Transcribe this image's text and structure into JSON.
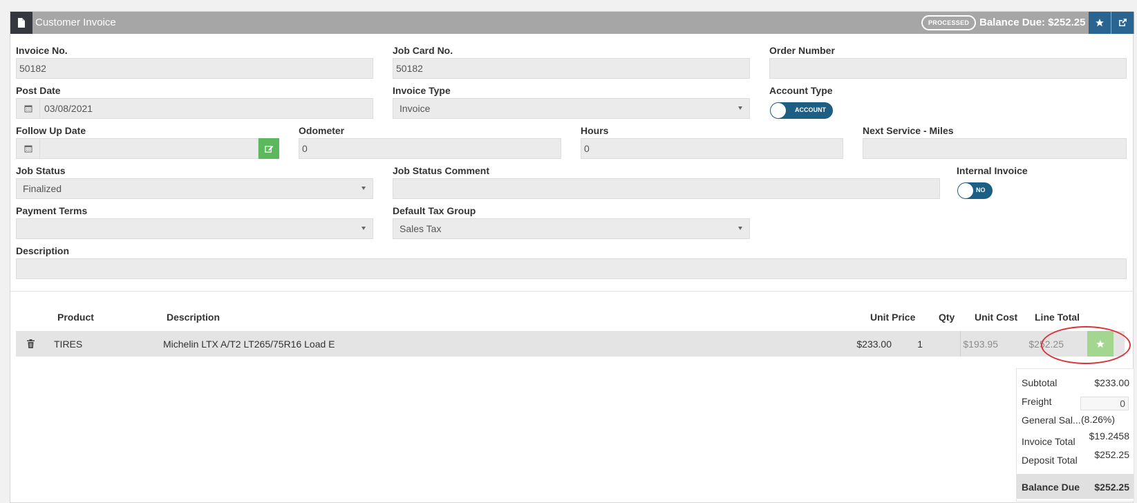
{
  "header": {
    "title": "Customer Invoice",
    "status_badge": "PROCESSED",
    "balance_due": "Balance Due: $252.25"
  },
  "fields": {
    "invoice_no": {
      "label": "Invoice No.",
      "value": "50182"
    },
    "job_card_no": {
      "label": "Job Card No.",
      "value": "50182"
    },
    "order_number": {
      "label": "Order Number",
      "value": ""
    },
    "post_date": {
      "label": "Post Date",
      "value": "03/08/2021"
    },
    "invoice_type": {
      "label": "Invoice Type",
      "value": "Invoice"
    },
    "account_type": {
      "label": "Account Type",
      "value": "ACCOUNT"
    },
    "follow_up_date": {
      "label": "Follow Up Date",
      "value": ""
    },
    "odometer": {
      "label": "Odometer",
      "value": "0"
    },
    "hours": {
      "label": "Hours",
      "value": "0"
    },
    "next_service_miles": {
      "label": "Next Service - Miles",
      "value": ""
    },
    "job_status": {
      "label": "Job Status",
      "value": "Finalized"
    },
    "job_status_comment": {
      "label": "Job Status Comment",
      "value": ""
    },
    "internal_invoice": {
      "label": "Internal Invoice",
      "value": "NO"
    },
    "payment_terms": {
      "label": "Payment Terms",
      "value": ""
    },
    "default_tax_group": {
      "label": "Default Tax Group",
      "value": "Sales Tax"
    },
    "description": {
      "label": "Description",
      "value": ""
    }
  },
  "line_items": {
    "columns": {
      "product": "Product",
      "description": "Description",
      "unit_price": "Unit Price",
      "qty": "Qty",
      "unit_cost": "Unit Cost",
      "line_total": "Line Total"
    },
    "rows": [
      {
        "product": "TIRES",
        "description": "Michelin LTX A/T2 LT265/75R16 Load E",
        "unit_price": "$233.00",
        "qty": "1",
        "unit_cost": "$193.95",
        "line_total": "$252.25"
      }
    ]
  },
  "totals": {
    "subtotal_label": "Subtotal",
    "subtotal_value": "$233.00",
    "freight_label": "Freight",
    "freight_value": "0",
    "tax_label": "General Sal...",
    "tax_rate": "(8.26%)",
    "tax_value": "$19.2458",
    "invoice_total_label": "Invoice Total",
    "invoice_total_value": "$252.25",
    "deposit_total_label": "Deposit Total",
    "balance_due_label": "Balance Due",
    "balance_due_value": "$252.25"
  },
  "icons": {
    "title": "document-icon",
    "star": "star-icon",
    "external": "external-link-icon",
    "calendar": "calendar-icon",
    "edit": "edit-icon",
    "trash": "trash-icon"
  },
  "colors": {
    "header_bg": "#a6a6a6",
    "header_button": "#2a6592",
    "toggle": "#1d5f82",
    "green": "#5cb85c",
    "annotation_circle": "#d9343a"
  }
}
